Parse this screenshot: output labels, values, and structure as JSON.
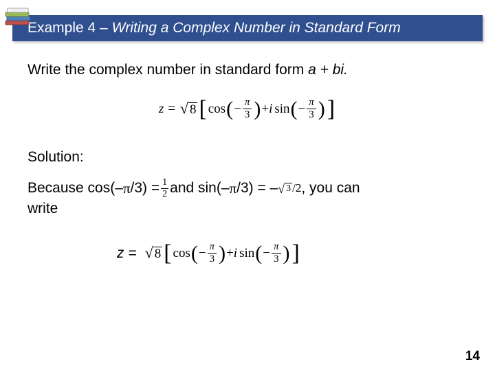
{
  "title": {
    "example_label": "Example 4",
    "separator": " – ",
    "example_desc": "Writing a Complex Number in Standard Form"
  },
  "prompt": {
    "text_before": "Write the complex number in standard form ",
    "abi": "a + bi."
  },
  "equation1": {
    "z_eq": "z =",
    "radicand": "8",
    "cos": "cos",
    "sin": "sin",
    "plus_i": " + ",
    "i": "i",
    "neg": "−",
    "pi": "π",
    "three": "3"
  },
  "solution_label": "Solution:",
  "explain": {
    "t1": "Because cos(–",
    "pi1": "π",
    "t2": "/3) = ",
    "half_num": "1",
    "half_den": "2",
    "t3": " and sin(–",
    "pi2": "π",
    "t4": "/3) = – ",
    "root3": "3",
    "root_div": "/2",
    "t5": ", you can",
    "t6": "write"
  },
  "equation2": {
    "zeq": "z ="
  },
  "page_number": "14"
}
